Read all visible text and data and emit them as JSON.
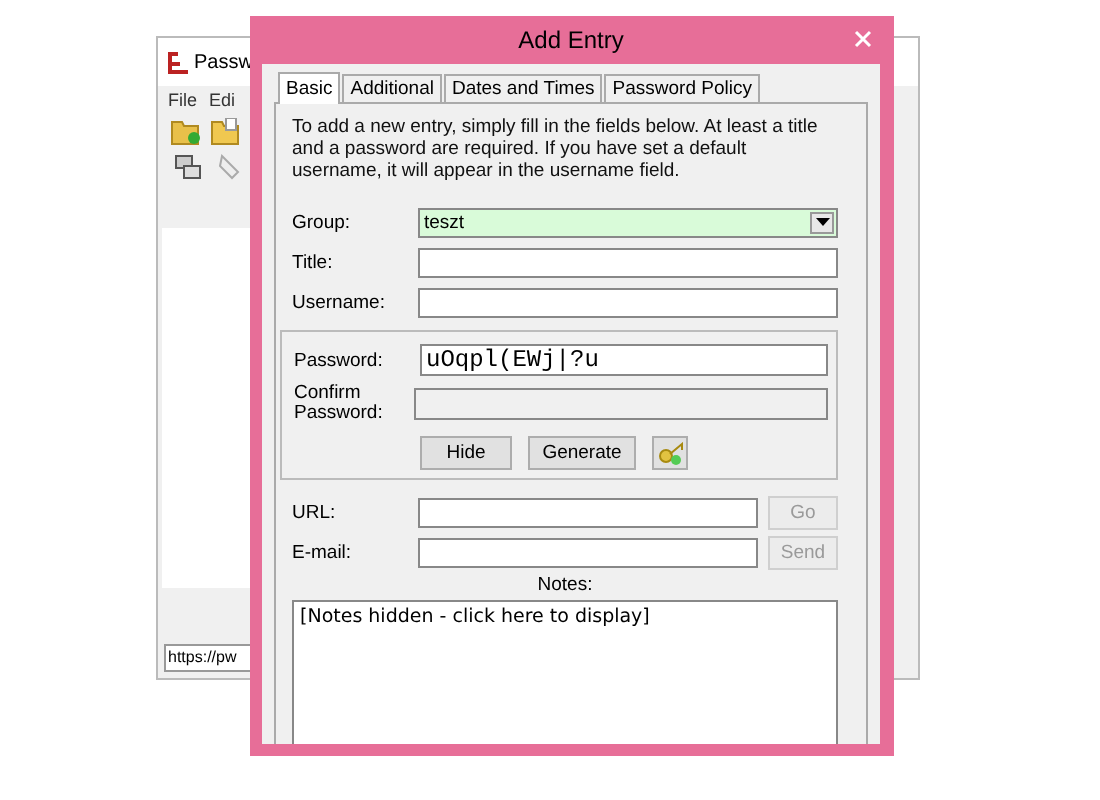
{
  "background_window": {
    "title": "Passw",
    "menu": [
      "File",
      "Edi"
    ],
    "status_text": "https://pw"
  },
  "dialog": {
    "title": "Add Entry",
    "tabs": [
      {
        "label": "Basic",
        "selected": true
      },
      {
        "label": "Additional",
        "selected": false
      },
      {
        "label": "Dates and Times",
        "selected": false
      },
      {
        "label": "Password Policy",
        "selected": false
      }
    ],
    "intro": "To add a new entry, simply fill in the fields below. At least a title and a password are required. If you have set a default username, it will appear in the username field.",
    "group": {
      "label": "Group:",
      "value": "teszt"
    },
    "title_field": {
      "label": "Title:"
    },
    "username": {
      "label": "Username:"
    },
    "password": {
      "label": "Password:",
      "value": "uOqpl(EWj|?u"
    },
    "confirm_password": {
      "label": "Confirm Password:",
      "disabled": true
    },
    "password_buttons": [
      "Hide",
      "Generate"
    ],
    "url": {
      "label": "URL:",
      "button": "Go",
      "button_disabled": true
    },
    "email": {
      "label": "E-mail:",
      "button": "Send",
      "button_disabled": true
    },
    "notes": {
      "label": "Notes:",
      "text": "[Notes hidden - click here to display]"
    }
  }
}
